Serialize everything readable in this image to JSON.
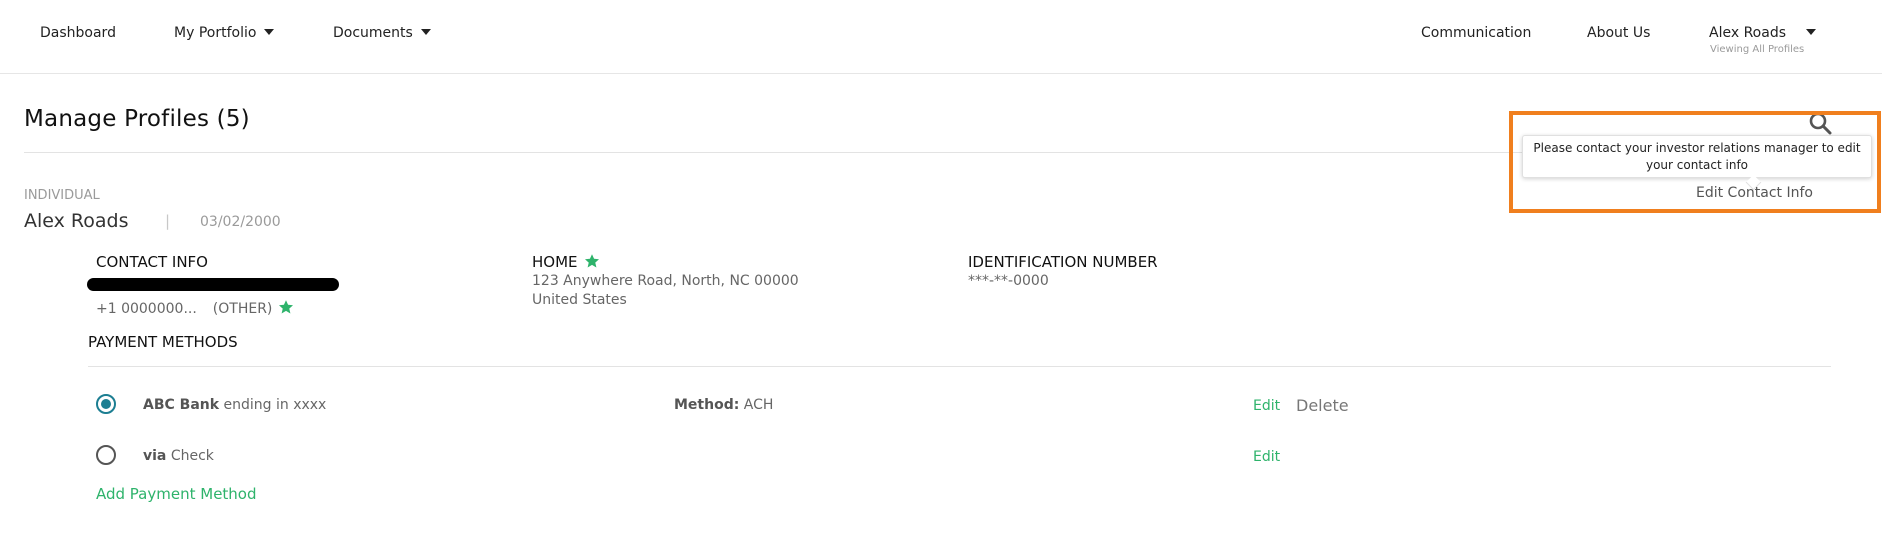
{
  "nav": {
    "dashboard": "Dashboard",
    "portfolio": "My Portfolio",
    "documents": "Documents",
    "communication": "Communication",
    "about": "About Us",
    "user_name": "Alex Roads",
    "user_sub": "Viewing All Profiles"
  },
  "page": {
    "title": "Manage Profiles (5)"
  },
  "tooltip": {
    "text": "Please contact your investor relations manager to edit your contact info",
    "edit_contact_label": "Edit Contact Info"
  },
  "profile": {
    "type": "INDIVIDUAL",
    "name": "Alex Roads",
    "separator": "|",
    "date": "03/02/2000"
  },
  "contact": {
    "heading": "CONTACT INFO",
    "phone": "+1 0000000...",
    "phone_type": "(OTHER)"
  },
  "home": {
    "heading": "HOME",
    "address_line1": "123 Anywhere Road, North, NC 00000",
    "address_line2": "United States"
  },
  "identification": {
    "heading": "IDENTIFICATION NUMBER",
    "value": "***-**-0000"
  },
  "payment": {
    "heading": "PAYMENT METHODS",
    "rows": [
      {
        "bank": "ABC Bank",
        "desc": "ending in xxxx",
        "method_label": "Method:",
        "method_value": "ACH",
        "edit": "Edit",
        "delete": "Delete",
        "selected": true
      },
      {
        "bank": "via",
        "desc": "Check",
        "edit": "Edit",
        "selected": false
      }
    ],
    "add_label": "Add Payment Method"
  },
  "colors": {
    "accent_green": "#2eb36b",
    "radio_teal": "#1c7e92",
    "highlight_orange": "#f07f1e",
    "star_green": "#2eb36b"
  },
  "icons": {
    "search": "search-icon",
    "star": "star-icon",
    "caret": "caret-down-icon"
  }
}
